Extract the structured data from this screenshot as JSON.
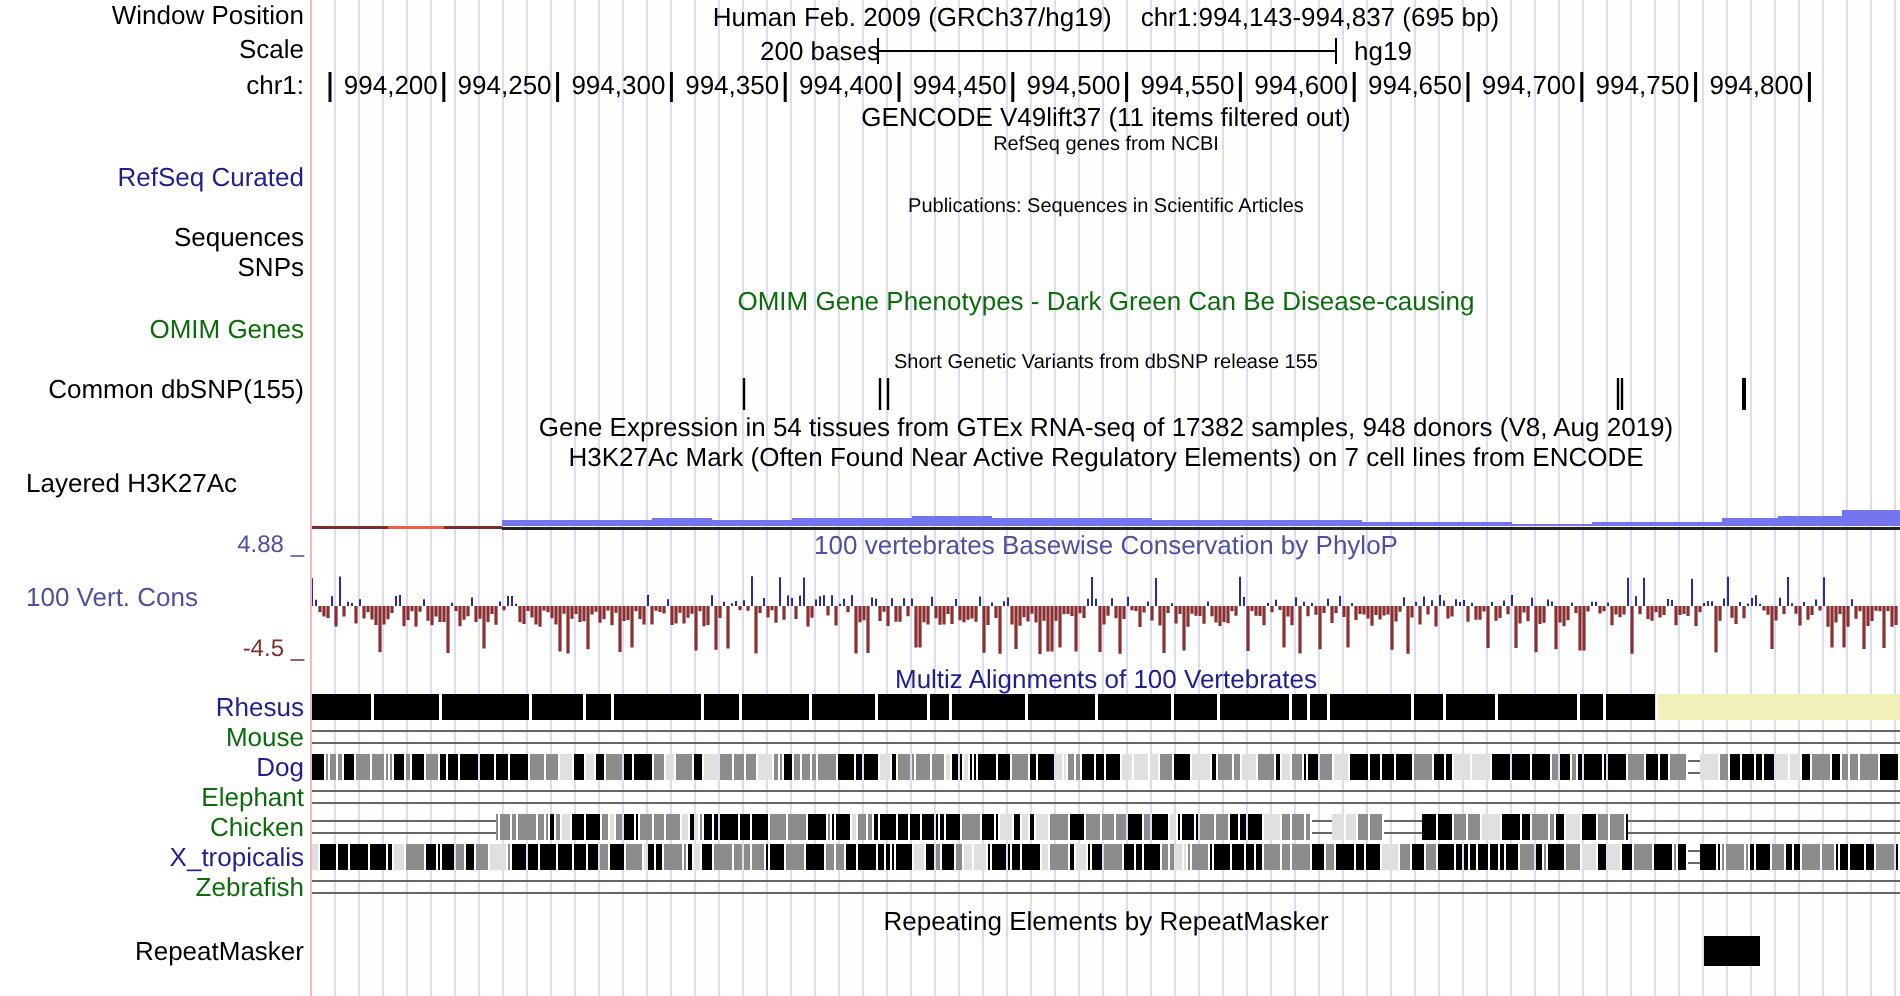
{
  "header": {
    "position_label": "Window Position",
    "assembly": "Human Feb. 2009 (GRCh37/hg19)",
    "position": "chr1:994,143-994,837 (695 bp)",
    "scale_label": "Scale",
    "scale_text": "200 bases",
    "scale_assembly": "hg19",
    "ruler_label": "chr1:",
    "ruler_ticks": [
      "994,200",
      "994,250",
      "994,300",
      "994,350",
      "994,400",
      "994,450",
      "994,500",
      "994,550",
      "994,600",
      "994,650",
      "994,700",
      "994,750",
      "994,800"
    ]
  },
  "tracks": [
    {
      "kind": "title",
      "title": "GENCODE V49lift37 (11 items filtered out)"
    },
    {
      "kind": "small_title",
      "label": "RefSeq Curated",
      "color": "#1f1f8f",
      "title": "RefSeq genes from NCBI"
    },
    {
      "kind": "publications",
      "title": "Publications: Sequences in Scientific Articles"
    },
    {
      "kind": "plain",
      "label": "Sequences"
    },
    {
      "kind": "plain",
      "label": "SNPs"
    },
    {
      "kind": "omim",
      "label": "OMIM Genes",
      "color": "#0c6c0c",
      "title": "OMIM Gene Phenotypes - Dark Green Can Be Disease-causing"
    },
    {
      "kind": "snp",
      "label": "Common dbSNP(155)",
      "title": "Short Genetic Variants from dbSNP release 155"
    },
    {
      "kind": "gtex",
      "title": "Gene Expression in 54 tissues from GTEx RNA-seq of 17382 samples, 948 donors (V8, Aug 2019)"
    },
    {
      "kind": "layered",
      "label": "Layered H3K27Ac",
      "title": "H3K27Ac Mark (Often Found Near Active Regulatory Elements) on 7 cell lines from ENCODE"
    },
    {
      "kind": "phylop",
      "label": "100 Vert. Cons",
      "color": "#5050a0",
      "title": "100 vertebrates Basewise Conservation by PhyloP",
      "y_max": "4.88 _",
      "y_min": "-4.5 _"
    },
    {
      "kind": "multiz",
      "title": "Multiz Alignments of 100 Vertebrates",
      "species": [
        {
          "name": "Rhesus",
          "color": "#1f1f8f",
          "kind": "aligned"
        },
        {
          "name": "Mouse",
          "color": "#0c6c0c",
          "kind": "none"
        },
        {
          "name": "Dog",
          "color": "#1f1f8f",
          "kind": "mixed"
        },
        {
          "name": "Elephant",
          "color": "#0c6c0c",
          "kind": "none"
        },
        {
          "name": "Chicken",
          "color": "#0c6c0c",
          "kind": "partial"
        },
        {
          "name": "X_tropicalis",
          "color": "#1f1f8f",
          "kind": "mixed"
        },
        {
          "name": "Zebrafish",
          "color": "#0c6c0c",
          "kind": "none"
        }
      ]
    },
    {
      "kind": "repeats",
      "label": "RepeatMasker",
      "title": "Repeating Elements by RepeatMasker"
    }
  ]
}
